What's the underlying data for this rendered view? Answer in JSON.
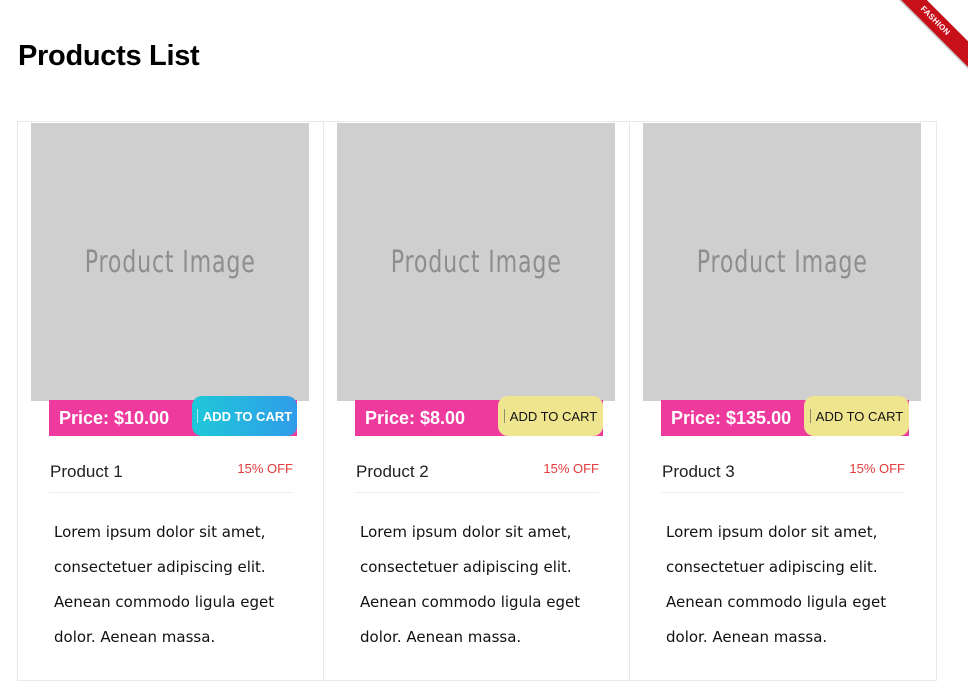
{
  "ribbon": {
    "label": "FASHION"
  },
  "page": {
    "title": "Products List"
  },
  "products": [
    {
      "image_placeholder": "Product Image",
      "price": "Price: $10.00",
      "cart_label": "ADD TO CART",
      "cart_style": "gradient",
      "name": "Product 1",
      "discount": "15% OFF",
      "description": "Lorem ipsum dolor sit amet, consectetuer adipiscing elit. Aenean commodo ligula eget dolor. Aenean massa."
    },
    {
      "image_placeholder": "Product Image",
      "price": "Price: $8.00",
      "cart_label": "ADD TO CART",
      "cart_style": "yellow",
      "name": "Product 2",
      "discount": "15% OFF",
      "description": "Lorem ipsum dolor sit amet, consectetuer adipiscing elit. Aenean commodo ligula eget dolor. Aenean massa."
    },
    {
      "image_placeholder": "Product Image",
      "price": "Price: $135.00",
      "cart_label": "ADD TO CART",
      "cart_style": "yellow",
      "name": "Product 3",
      "discount": "15% OFF",
      "description": "Lorem ipsum dolor sit amet, consectetuer adipiscing elit. Aenean commodo ligula eget dolor. Aenean massa."
    }
  ],
  "colors": {
    "price_bar": "#ee3a9c",
    "cart_gradient_start": "#1fc8d8",
    "cart_gradient_end": "#2f9ce9",
    "cart_yellow": "#efe58e",
    "discount": "#e23b3b",
    "ribbon": "#c8101a",
    "image_placeholder": "#cfcfcf"
  }
}
